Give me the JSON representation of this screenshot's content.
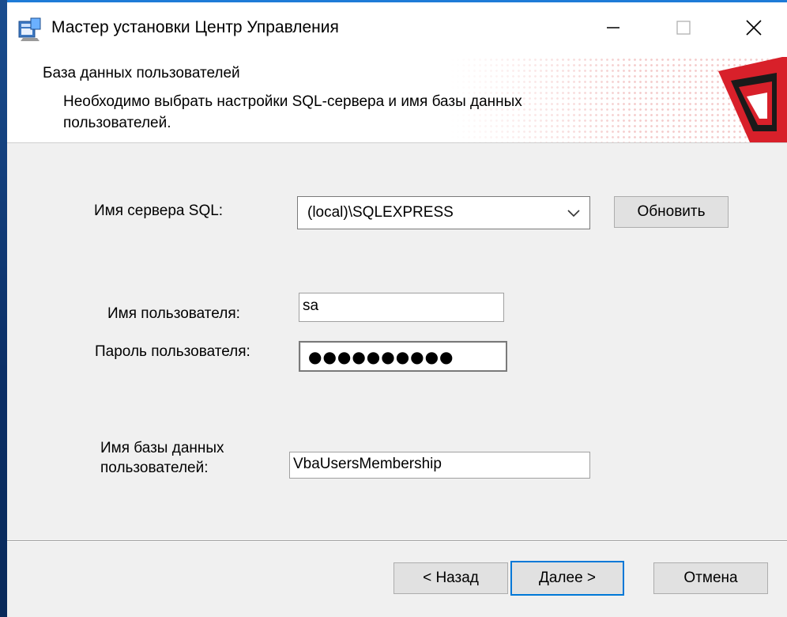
{
  "window": {
    "title": "Мастер установки Центр Управления",
    "controls": {
      "minimize": "minimize-icon",
      "maximize": "maximize-icon",
      "close": "close-icon"
    }
  },
  "header": {
    "title": "База данных пользователей",
    "subtitle": "Необходимо выбрать настройки SQL-сервера и имя базы данных пользователей.",
    "logo": "vba-logo"
  },
  "form": {
    "sql_server_label": "Имя сервера SQL:",
    "sql_server_value": "(local)\\SQLEXPRESS",
    "refresh_label": "Обновить",
    "username_label": "Имя пользователя:",
    "username_value": "sa",
    "password_label": "Пароль пользователя:",
    "password_mask": "●●●●●●●●●●",
    "db_name_label_line1": "Имя базы данных",
    "db_name_label_line2": "пользователей:",
    "db_name_value": "VbaUsersMembership"
  },
  "footer": {
    "back_label": "< Назад",
    "next_label": "Далее >",
    "cancel_label": "Отмена"
  },
  "colors": {
    "accent": "#0078d7",
    "title_border": "#1e7bd7",
    "logo_red": "#d8202a"
  }
}
